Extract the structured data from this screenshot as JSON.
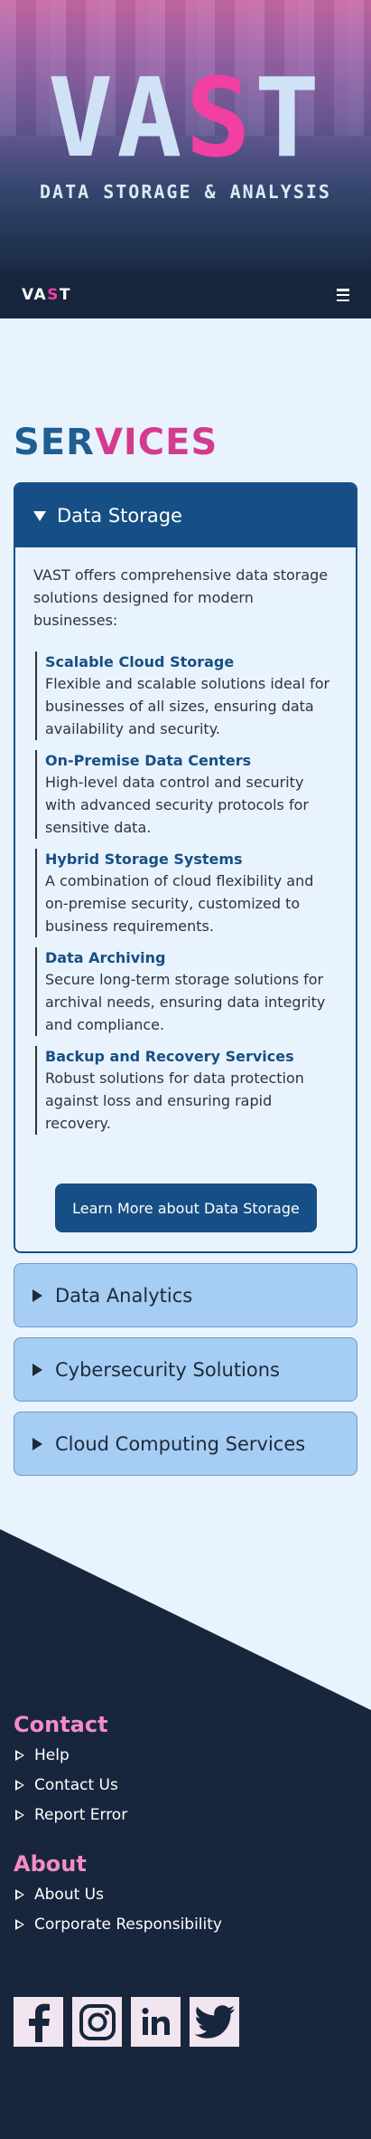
{
  "hero": {
    "title_part1": "VA",
    "title_part2": "S",
    "title_part3": "T",
    "subtitle": "DATA STORAGE & ANALYSIS"
  },
  "nav": {
    "logo_part1": "VA",
    "logo_part2": "S",
    "logo_part3": "T",
    "menu_icon": "hamburger-icon"
  },
  "services": {
    "title_part1": "SER",
    "title_part2": "VICES",
    "open_panel": {
      "label": "Data Storage",
      "intro": "VAST offers comprehensive data storage solutions designed for modern businesses:",
      "items": [
        {
          "title": "Scalable Cloud Storage",
          "desc": "Flexible and scalable solutions ideal for businesses of all sizes, ensuring data availability and security."
        },
        {
          "title": "On-Premise Data Centers",
          "desc": "High-level data control and security with advanced security protocols for sensitive data."
        },
        {
          "title": "Hybrid Storage Systems",
          "desc": "A combination of cloud flexibility and on-premise security, customized to business requirements."
        },
        {
          "title": "Data Archiving",
          "desc": "Secure long-term storage solutions for archival needs, ensuring data integrity and compliance."
        },
        {
          "title": "Backup and Recovery Services",
          "desc": "Robust solutions for data protection against loss and ensuring rapid recovery."
        }
      ],
      "button": "Learn More about Data Storage"
    },
    "closed_panels": [
      {
        "label": "Data Analytics"
      },
      {
        "label": "Cybersecurity Solutions"
      },
      {
        "label": "Cloud Computing Services"
      }
    ]
  },
  "footer": {
    "contact": {
      "heading": "Contact",
      "links": [
        "Help",
        "Contact Us",
        "Report Error"
      ]
    },
    "about": {
      "heading": "About",
      "links": [
        "About Us",
        "Corporate Responsibility"
      ]
    },
    "social": [
      "facebook-icon",
      "instagram-icon",
      "linkedin-icon",
      "twitter-icon"
    ]
  },
  "colors": {
    "accent_pink": "#f23fa2",
    "primary_blue": "#164f85",
    "footer_bg": "#17263d",
    "footer_heading": "#f48cc6",
    "panel_closed": "#a6cdf3",
    "page_bg": "#e9f3fd"
  }
}
